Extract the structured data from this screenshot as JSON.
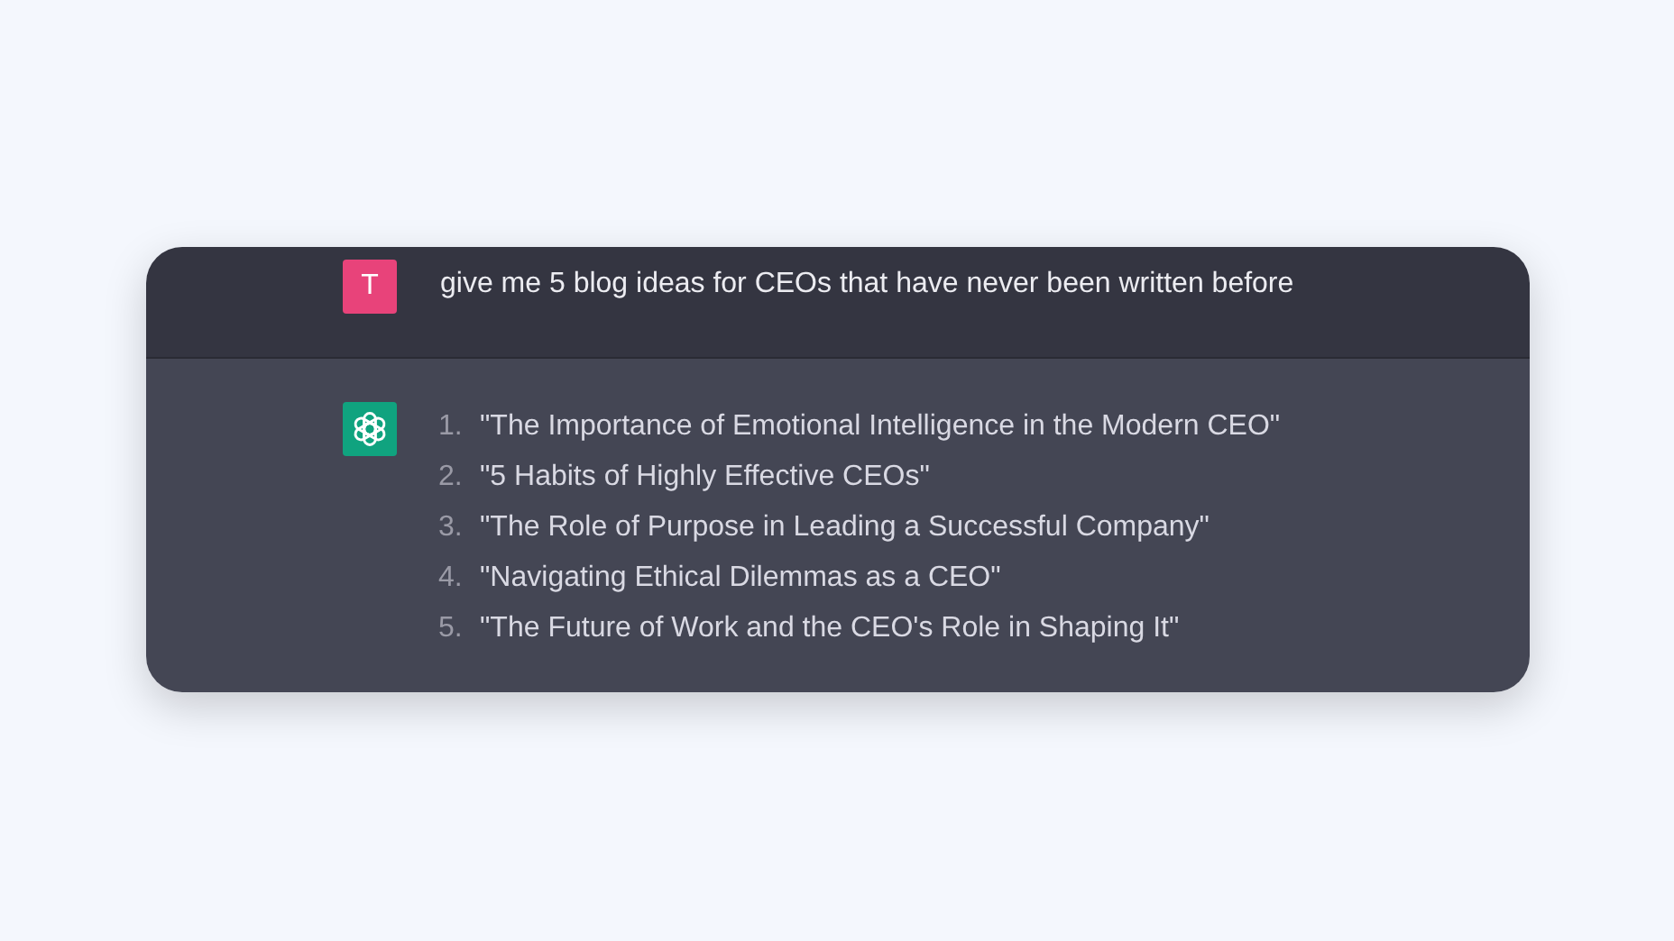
{
  "user_message": {
    "avatar_letter": "T",
    "text": "give me 5 blog ideas for CEOs that have never been written before"
  },
  "assistant_message": {
    "items": [
      {
        "number": "1.",
        "text": "\"The Importance of Emotional Intelligence in the Modern CEO\""
      },
      {
        "number": "2.",
        "text": "\"5 Habits of Highly Effective CEOs\""
      },
      {
        "number": "3.",
        "text": "\"The Role of Purpose in Leading a Successful Company\""
      },
      {
        "number": "4.",
        "text": "\"Navigating Ethical Dilemmas as a CEO\""
      },
      {
        "number": "5.",
        "text": "\"The Future of Work and the CEO's Role in Shaping It\""
      }
    ]
  }
}
